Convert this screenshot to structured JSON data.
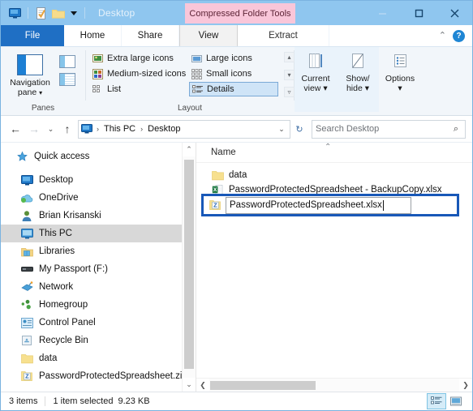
{
  "window": {
    "title": "Desktop",
    "contextual_tab_title": "Compressed Folder Tools",
    "quick_access": [
      {
        "name": "desktop-icon",
        "label": "Desktop"
      },
      {
        "name": "properties-icon",
        "label": "Properties"
      },
      {
        "name": "new-folder-icon",
        "label": "New folder"
      }
    ],
    "controls": {
      "minimize": "Minimize",
      "maximize": "Maximize",
      "close": "Close"
    }
  },
  "ribbon": {
    "tabs": [
      {
        "label": "File",
        "active": false
      },
      {
        "label": "Home",
        "active": false
      },
      {
        "label": "Share",
        "active": false
      },
      {
        "label": "View",
        "active": true
      },
      {
        "label": "Extract",
        "active": false
      }
    ],
    "collapse_chevron": "⌃",
    "help_label": "?",
    "groups": [
      {
        "label": "Panes",
        "navigation_pane": "Navigation\npane",
        "navigation_pane_line1": "Navigation",
        "navigation_pane_line2": "pane"
      },
      {
        "label": "Layout",
        "items": [
          {
            "label": "Extra large icons",
            "selected": false
          },
          {
            "label": "Large icons",
            "selected": false
          },
          {
            "label": "Medium-sized icons",
            "selected": false
          },
          {
            "label": "Small icons",
            "selected": false
          },
          {
            "label": "List",
            "selected": false
          },
          {
            "label": "Details",
            "selected": true
          }
        ]
      }
    ],
    "buttons": [
      {
        "line1": "Current",
        "line2": "view",
        "caret": true
      },
      {
        "line1": "Show/",
        "line2": "hide",
        "caret": true
      },
      {
        "line1": "Options",
        "line2": "",
        "caret": true
      }
    ]
  },
  "address": {
    "back": "←",
    "forward": "→",
    "recent": "⌄",
    "up": "↑",
    "crumbs": [
      "This PC",
      "Desktop"
    ],
    "crumb_separator": "›",
    "dropdown_caret": "⌄",
    "refresh": "↻",
    "search_placeholder": "Search Desktop",
    "search_value": "",
    "search_icon": "⌕"
  },
  "sidebar": {
    "items": [
      {
        "label": "Quick access",
        "icon": "star-icon",
        "selected": false,
        "spaced": true
      },
      {
        "label": "Desktop",
        "icon": "desktop-icon",
        "selected": false
      },
      {
        "label": "OneDrive",
        "icon": "onedrive-icon",
        "selected": false
      },
      {
        "label": "Brian Krisanski",
        "icon": "user-icon",
        "selected": false
      },
      {
        "label": "This PC",
        "icon": "this-pc-icon",
        "selected": true
      },
      {
        "label": "Libraries",
        "icon": "libraries-icon",
        "selected": false
      },
      {
        "label": "My Passport (F:)",
        "icon": "drive-icon",
        "selected": false
      },
      {
        "label": "Network",
        "icon": "network-icon",
        "selected": false
      },
      {
        "label": "Homegroup",
        "icon": "homegroup-icon",
        "selected": false
      },
      {
        "label": "Control Panel",
        "icon": "control-panel-icon",
        "selected": false
      },
      {
        "label": "Recycle Bin",
        "icon": "recycle-bin-icon",
        "selected": false
      },
      {
        "label": "data",
        "icon": "folder-icon",
        "selected": false
      },
      {
        "label": "PasswordProtectedSpreadsheet.zip",
        "icon": "zip-icon",
        "selected": false
      }
    ]
  },
  "file_list": {
    "column_header": "Name",
    "sort_indicator": "⌃",
    "rows": [
      {
        "name": "data",
        "icon": "folder-icon"
      },
      {
        "name": "PasswordProtectedSpreadsheet - BackupCopy.xlsx",
        "icon": "excel-icon"
      }
    ],
    "rename": {
      "icon": "zip-icon",
      "value": "PasswordProtectedSpreadsheet.xlsx"
    }
  },
  "status_bar": {
    "item_count": "3 items",
    "selection": "1 item selected",
    "size": "9.23 KB",
    "view_buttons": [
      {
        "name": "details-view-button",
        "active": true
      },
      {
        "name": "large-icons-view-button",
        "active": false
      }
    ]
  }
}
